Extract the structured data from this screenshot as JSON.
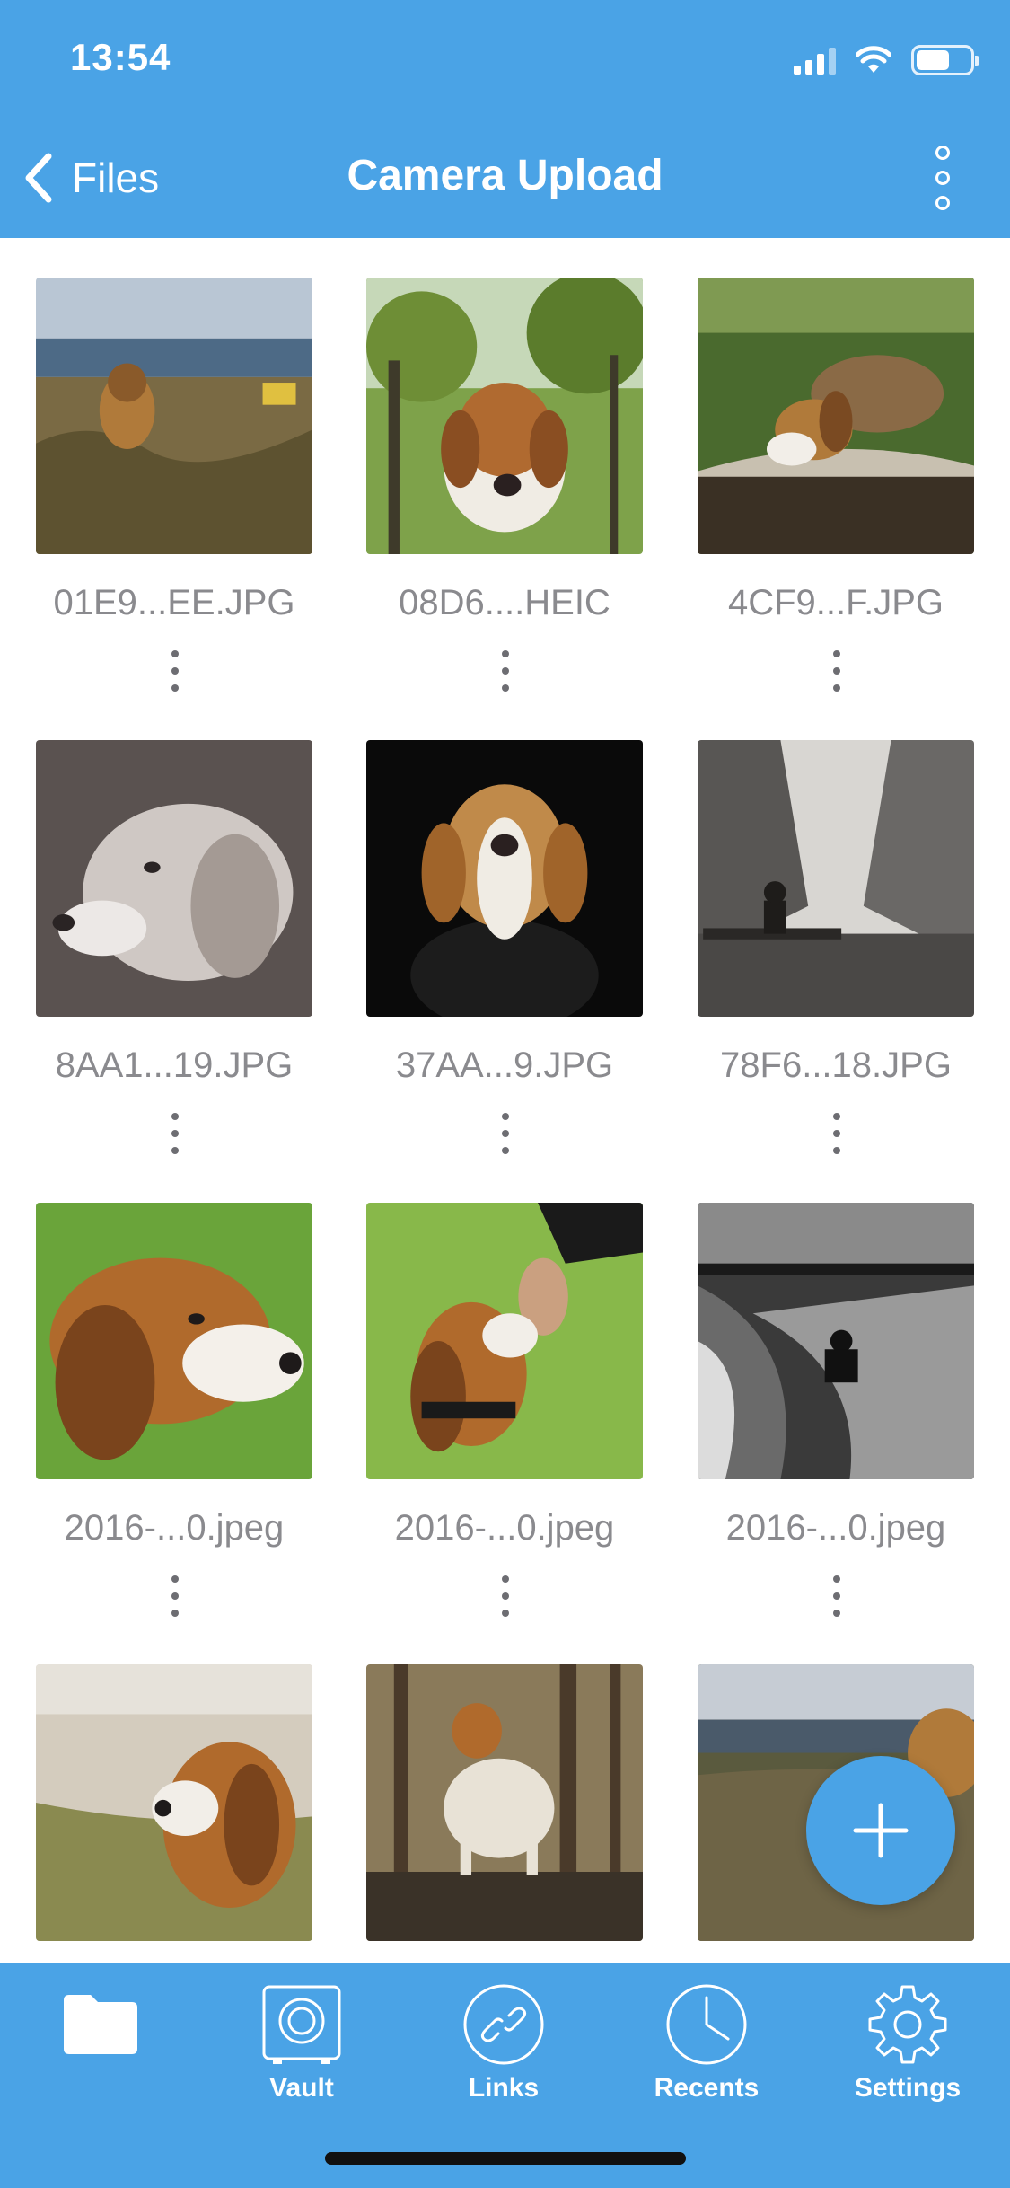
{
  "status_bar": {
    "time": "13:54"
  },
  "nav": {
    "back_label": "Files",
    "title": "Camera Upload"
  },
  "files": [
    {
      "name": "01E9...EE.JPG"
    },
    {
      "name": "08D6....HEIC"
    },
    {
      "name": "4CF9...F.JPG"
    },
    {
      "name": "8AA1...19.JPG"
    },
    {
      "name": "37AA...9.JPG"
    },
    {
      "name": "78F6...18.JPG"
    },
    {
      "name": "2016-...0.jpeg"
    },
    {
      "name": "2016-...0.jpeg"
    },
    {
      "name": "2016-...0.jpeg"
    },
    {
      "name": ""
    },
    {
      "name": ""
    },
    {
      "name": ""
    }
  ],
  "tabbar": {
    "items": [
      {
        "label": "",
        "icon": "folder-icon"
      },
      {
        "label": "Vault",
        "icon": "vault-icon"
      },
      {
        "label": "Links",
        "icon": "link-icon"
      },
      {
        "label": "Recents",
        "icon": "clock-icon"
      },
      {
        "label": "Settings",
        "icon": "gear-icon"
      }
    ]
  },
  "colors": {
    "accent": "#4aa3e6",
    "filename": "#8a8a8e"
  }
}
